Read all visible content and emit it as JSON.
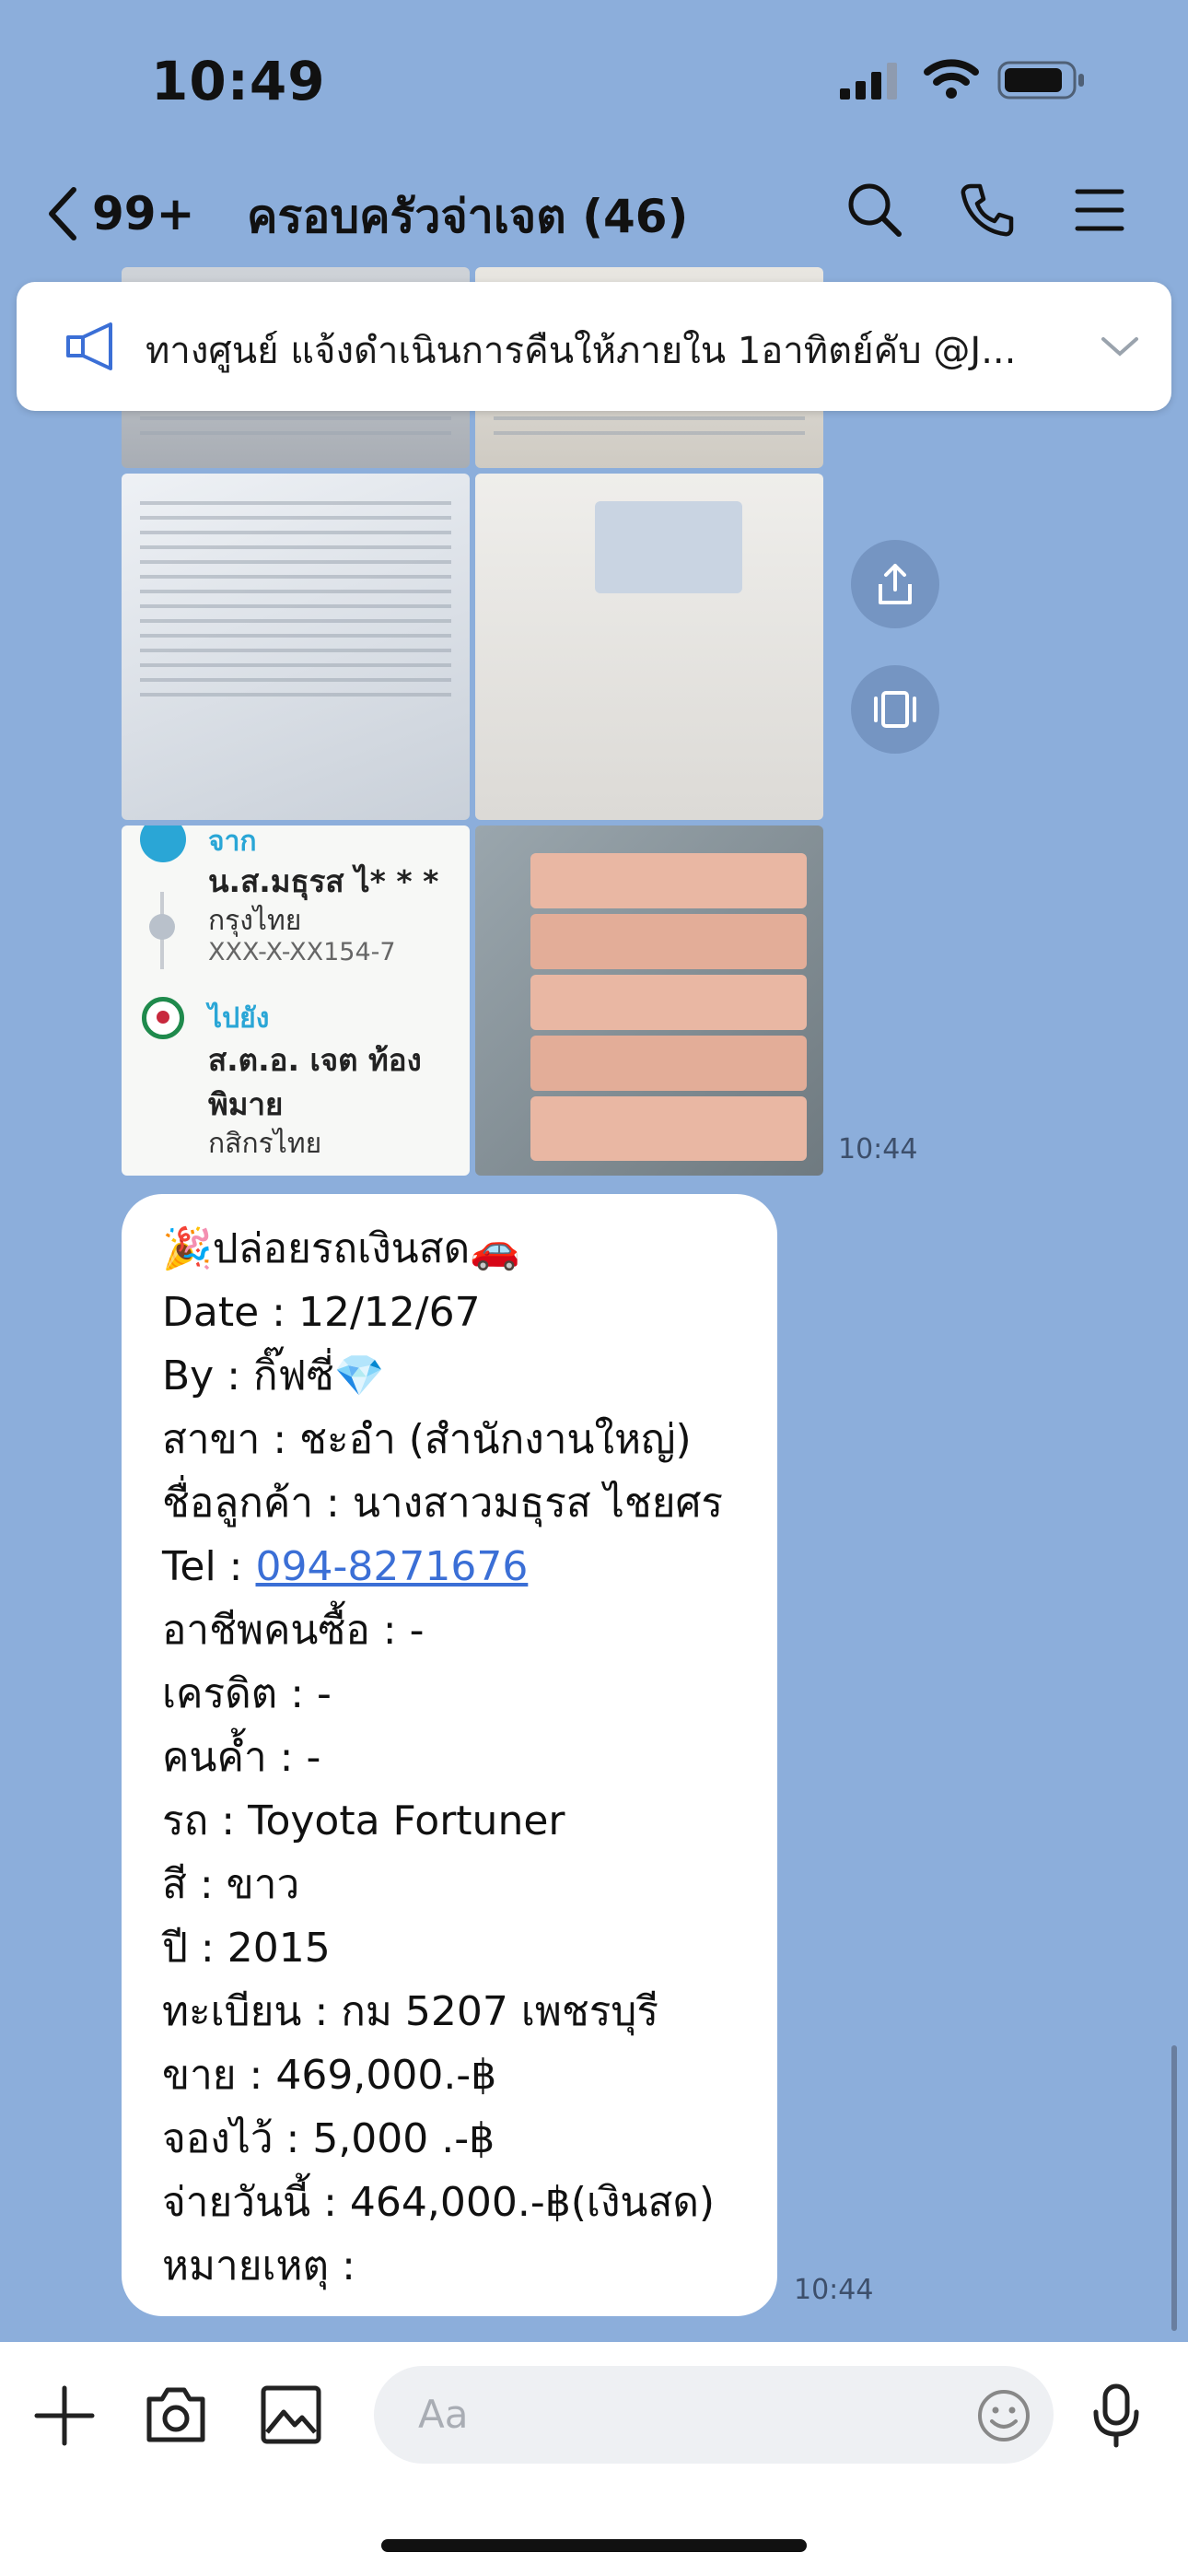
{
  "status_bar": {
    "time": "10:49",
    "icons": [
      "signal-icon",
      "wifi-icon",
      "battery-icon"
    ]
  },
  "header": {
    "back_icon": "chevron-left-icon",
    "unread_count": "99+",
    "title": "ครอบครัวจ่าเจต (46)",
    "actions": [
      "search-icon",
      "phone-icon",
      "menu-icon"
    ]
  },
  "announcement": {
    "icon": "megaphone-icon",
    "text": "ทางศูนย์ แจ้งดำเนินการคืนให้ภายใน 1อาทิตย์คับ @J...",
    "expand_icon": "chevron-down-icon"
  },
  "photo_message": {
    "time": "10:44",
    "transfer_slip": {
      "from_label": "จาก",
      "from_name": "น.ส.มธุรส ไ* * *",
      "from_bank": "กรุงไทย",
      "from_account": "XXX-X-XX154-7",
      "to_label": "ไปยัง",
      "to_name_line1": "ส.ต.อ. เจต ท้อง",
      "to_name_line2": "พิมาย",
      "to_bank": "กสิกรไทย"
    },
    "side_actions": [
      "share-icon",
      "forward-icon"
    ]
  },
  "text_message": {
    "time": "10:44",
    "lines": [
      "🎉ปล่อยรถเงินสด🚗",
      "Date : 12/12/67",
      "By : กิ๊ฟซี่💎",
      "สาขา : ชะอำ (สำนักงานใหญ่)",
      "ชื่อลูกค้า : นางสาวมธุรส ไชยศร",
      "Tel : ",
      "อาชีพคนซื้อ : -",
      "เครดิต : -",
      "คนค้ำ : -",
      "รถ : Toyota Fortuner",
      "สี : ขาว",
      "ปี : 2015",
      "ทะเบียน : กม 5207 เพชรบุรี",
      "ขาย : 469,000.-฿",
      "จองไว้ : 5,000 .-฿",
      "จ่ายวันนี้ : 464,000.-฿(เงินสด)",
      "หมายเหตุ :"
    ],
    "tel_link": "094-8271676"
  },
  "input_bar": {
    "placeholder": "Aa",
    "icons": [
      "plus-icon",
      "camera-icon",
      "image-icon",
      "emoji-icon",
      "microphone-icon"
    ]
  },
  "colors": {
    "background": "#8caedb",
    "link": "#3b6fd6",
    "accent": "#2aa6d6"
  }
}
